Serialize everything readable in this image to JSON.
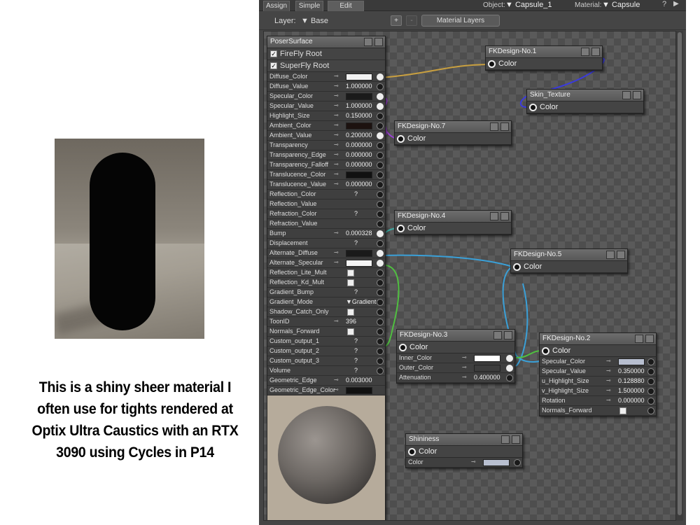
{
  "caption": "This is a shiny sheer material I often use for tights rendered at Optix Ultra Caustics with an RTX 3090 using Cycles in P14",
  "topbar": {
    "tabs": [
      "Assign",
      "Simple",
      "Edit"
    ],
    "object_label": "Object:",
    "object_value": "Capsule_1",
    "material_label": "Material:",
    "material_value": "Capsule",
    "help": "?",
    "play": "▶"
  },
  "layerbar": {
    "layer_label": "Layer:",
    "layer_value": "Base",
    "add": "+",
    "remove": "-",
    "material_layers": "Material Layers"
  },
  "root": {
    "title": "PoserSurface",
    "checks": [
      "FireFly Root",
      "SuperFly Root"
    ],
    "params": [
      {
        "label": "Diffuse_Color",
        "type": "color",
        "color": "#f2f2f2",
        "pin": "con"
      },
      {
        "label": "Diffuse_Value",
        "type": "num",
        "value": "1.000000"
      },
      {
        "label": "Specular_Color",
        "type": "color",
        "color": "#1a1a1a",
        "pin": "con"
      },
      {
        "label": "Specular_Value",
        "type": "num",
        "value": "1.000000",
        "pin": "con"
      },
      {
        "label": "Highlight_Size",
        "type": "num",
        "value": "0.150000"
      },
      {
        "label": "Ambient_Color",
        "type": "color",
        "color": "#1c1210"
      },
      {
        "label": "Ambient_Value",
        "type": "num",
        "value": "0.200000",
        "pin": "con"
      },
      {
        "label": "Transparency",
        "type": "num",
        "value": "0.000000"
      },
      {
        "label": "Transparency_Edge",
        "type": "num",
        "value": "0.000000"
      },
      {
        "label": "Transparency_Falloff",
        "type": "num",
        "value": "0.000000"
      },
      {
        "label": "Translucence_Color",
        "type": "color",
        "color": "#111111"
      },
      {
        "label": "Translucence_Value",
        "type": "num",
        "value": "0.000000"
      },
      {
        "label": "Reflection_Color",
        "type": "q",
        "value": "?"
      },
      {
        "label": "Reflection_Value",
        "type": "none"
      },
      {
        "label": "Refraction_Color",
        "type": "q",
        "value": "?"
      },
      {
        "label": "Refraction_Value",
        "type": "none"
      },
      {
        "label": "Bump",
        "type": "num",
        "value": "0.000328",
        "pin": "con"
      },
      {
        "label": "Displacement",
        "type": "q",
        "value": "?"
      },
      {
        "label": "Alternate_Diffuse",
        "type": "color",
        "color": "#1a1a1a",
        "pin": "con"
      },
      {
        "label": "Alternate_Specular",
        "type": "color",
        "color": "#f5f5f5",
        "pin": "con"
      },
      {
        "label": "Reflection_Lite_Mult",
        "type": "check"
      },
      {
        "label": "Reflection_Kd_Mult",
        "type": "check"
      },
      {
        "label": "Gradient_Bump",
        "type": "q",
        "value": "?"
      },
      {
        "label": "Gradient_Mode",
        "type": "text",
        "value": "▼Gradient B"
      },
      {
        "label": "Shadow_Catch_Only",
        "type": "check"
      },
      {
        "label": "ToonID",
        "type": "num",
        "value": "396"
      },
      {
        "label": "Normals_Forward",
        "type": "check"
      },
      {
        "label": "Custom_output_1",
        "type": "q",
        "value": "?"
      },
      {
        "label": "Custom_output_2",
        "type": "q",
        "value": "?"
      },
      {
        "label": "Custom_output_3",
        "type": "q",
        "value": "?"
      },
      {
        "label": "Volume",
        "type": "q",
        "value": "?"
      },
      {
        "label": "Geometric_Edge",
        "type": "num",
        "value": "0.003000",
        "nopin": true
      },
      {
        "label": "Geometric_Edge_Color",
        "type": "color",
        "color": "#111111",
        "nopin": true
      }
    ]
  },
  "nodes": {
    "n1": {
      "title": "FKDesign-No.1",
      "out": "Color"
    },
    "skin": {
      "title": "Skin_Texture",
      "out": "Color"
    },
    "n7": {
      "title": "FKDesign-No.7",
      "out": "Color"
    },
    "n4": {
      "title": "FKDesign-No.4",
      "out": "Color"
    },
    "n5": {
      "title": "FKDesign-No.5",
      "out": "Color"
    },
    "n3": {
      "title": "FKDesign-No.3",
      "out": "Color",
      "params": [
        {
          "label": "Inner_Color",
          "type": "color",
          "color": "#ffffff",
          "pin": "con"
        },
        {
          "label": "Outer_Color",
          "type": "color",
          "color": "#3d3d3d",
          "pin": "con"
        },
        {
          "label": "Attenuation",
          "type": "num",
          "value": "0.400000"
        }
      ]
    },
    "n2": {
      "title": "FKDesign-No.2",
      "out": "Color",
      "params": [
        {
          "label": "Specular_Color",
          "type": "color",
          "color": "#b8bfd0"
        },
        {
          "label": "Specular_Value",
          "type": "num",
          "value": "0.350000"
        },
        {
          "label": "u_Highlight_Size",
          "type": "num",
          "value": "0.128880"
        },
        {
          "label": "v_Highlight_Size",
          "type": "num",
          "value": "1.500000"
        },
        {
          "label": "Rotation",
          "type": "num",
          "value": "0.000000"
        },
        {
          "label": "Normals_Forward",
          "type": "check"
        }
      ]
    },
    "shin": {
      "title": "Shininess",
      "out": "Color",
      "params": [
        {
          "label": "Color",
          "type": "color",
          "color": "#b8bfd0"
        }
      ]
    }
  },
  "colors": {
    "wire_gold": "#c9a040",
    "wire_blue": "#3a3ae0",
    "wire_purple": "#9a40d0",
    "wire_teal": "#3aa8a0",
    "wire_cyan": "#3aa0d8",
    "wire_green": "#50c040"
  }
}
